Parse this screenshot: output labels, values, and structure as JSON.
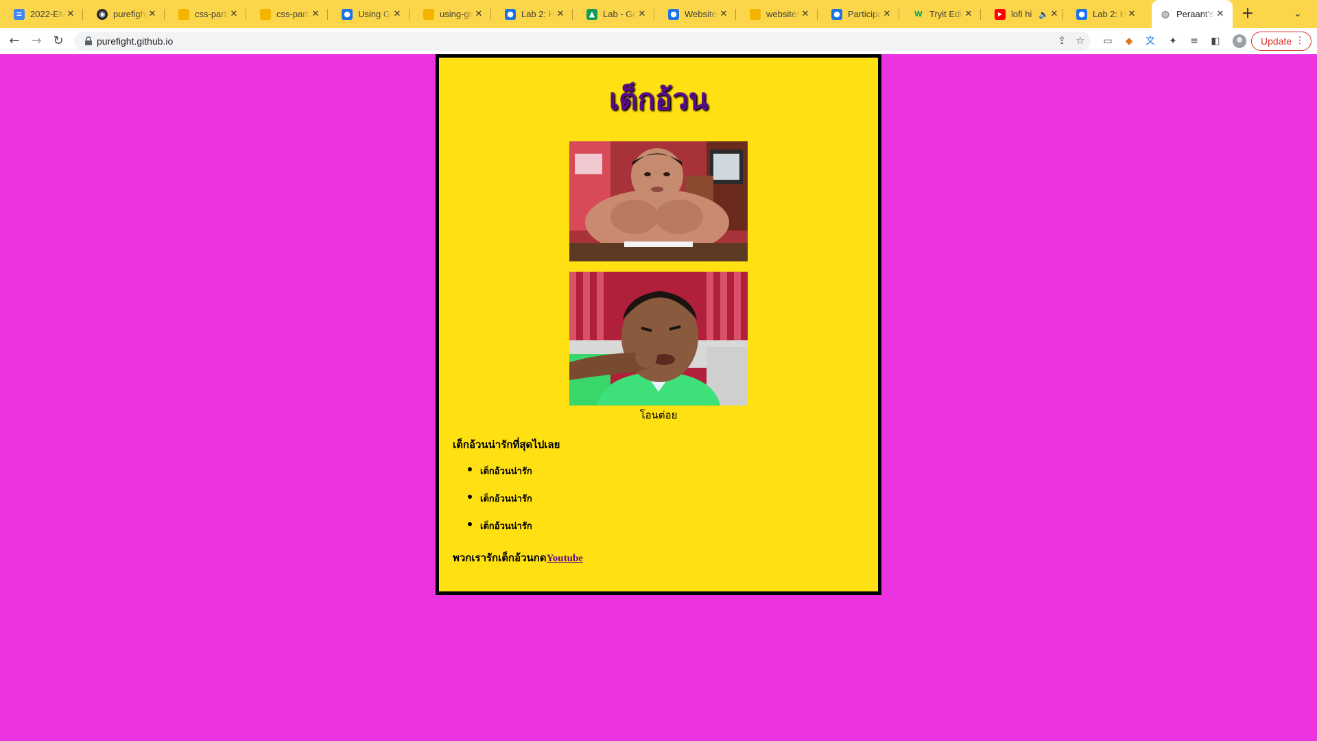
{
  "browser": {
    "tabs": [
      {
        "title": "2022-EN",
        "icon": "google-docs-icon",
        "color": "#4285f4"
      },
      {
        "title": "purefight/",
        "icon": "github-icon",
        "color": "#24292e"
      },
      {
        "title": "css-part1",
        "icon": "google-slides-icon",
        "color": "#f4b400"
      },
      {
        "title": "css-part2",
        "icon": "google-slides-icon",
        "color": "#f4b400"
      },
      {
        "title": "Using Git",
        "icon": "google-classroom-icon",
        "color": "#1a73e8"
      },
      {
        "title": "using-git",
        "icon": "google-slides-icon",
        "color": "#f4b400"
      },
      {
        "title": "Lab 2: HT",
        "icon": "google-classroom-icon",
        "color": "#1a73e8"
      },
      {
        "title": "Lab - Goo",
        "icon": "google-drive-icon",
        "color": "#0f9d58"
      },
      {
        "title": "Websites",
        "icon": "google-classroom-icon",
        "color": "#1a73e8"
      },
      {
        "title": "websites-",
        "icon": "google-slides-icon",
        "color": "#f4b400"
      },
      {
        "title": "Participat",
        "icon": "google-classroom-icon",
        "color": "#1a73e8"
      },
      {
        "title": "Tryit Edito",
        "icon": "w3schools-icon",
        "color": "#04aa6d"
      },
      {
        "title": "lofi hi",
        "icon": "youtube-icon",
        "color": "#ff0000"
      },
      {
        "title": "Lab 2: HT",
        "icon": "google-classroom-icon",
        "color": "#1a73e8"
      },
      {
        "title": "Peraant's",
        "icon": "globe-icon",
        "color": "#5f6368"
      }
    ],
    "url": "purefight.github.io",
    "update_label": "Update"
  },
  "page": {
    "heading": "เต็กอ้วน",
    "caption": "โอนต่อย",
    "subheading": "เต็กอ้วนน่ารักที่สุดไปเลย",
    "list_items": [
      "เต็กอ้วนน่ารัก",
      "เต็กอ้วนน่ารัก",
      "เต็กอ้วนน่ารัก"
    ],
    "footer_text": "พวกเรารักเต็กอ้วนกด",
    "footer_link": "Youtube"
  },
  "colors": {
    "page_background": "#ec33e1",
    "card_background": "#fee013",
    "heading_color": "#5a0b8a",
    "tabbar_background": "#fcd64a"
  }
}
